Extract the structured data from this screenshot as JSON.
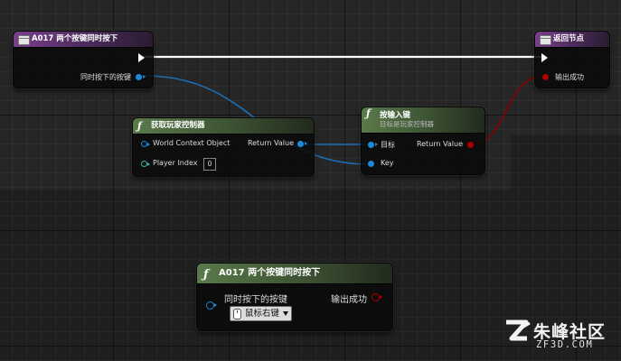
{
  "colors": {
    "exec_wire": "#ffffff",
    "object_wire": "#1c8ad8",
    "bool_wire": "#a00000",
    "event_header": "#7a3f8e",
    "function_header": "#5a7a4a"
  },
  "nodes": {
    "entry": {
      "title": "A017 两个按键同时按下",
      "icon": "event-icon",
      "pin_pressed": "同时按下的按键"
    },
    "return": {
      "title": "返回节点",
      "icon": "event-icon",
      "pin_output": "输出成功"
    },
    "get_controller": {
      "title": "获取玩家控制器",
      "icon": "function-f-icon",
      "pin_world": "World Context Object",
      "pin_player_index": "Player Index",
      "player_index_value": "0",
      "pin_return": "Return Value"
    },
    "input_key": {
      "title": "按输入键",
      "subtitle": "目标是玩家控制器",
      "icon": "function-f-icon",
      "pin_target": "目标",
      "pin_key": "Key",
      "pin_return": "Return Value"
    },
    "call_node": {
      "title": "A017 两个按键同时按下",
      "icon": "function-f-icon",
      "pin_pressed": "同时按下的按键",
      "pin_output": "输出成功",
      "dropdown_value": "鼠标右键"
    }
  },
  "watermark": {
    "name": "朱峰社区",
    "domain": "ZF3D.COM"
  }
}
